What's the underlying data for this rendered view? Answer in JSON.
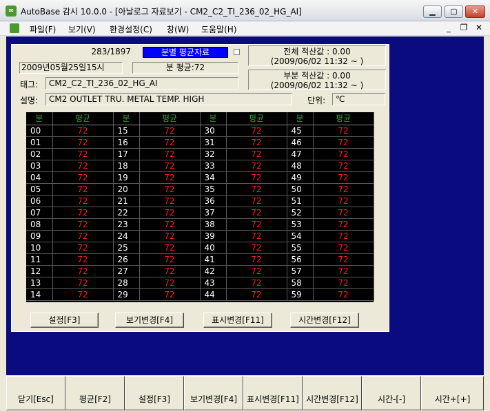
{
  "window": {
    "title": "AutoBase 감시 10.0.0 - [아날로그 자료보기 - CM2_C2_TI_236_02_HG_AI]",
    "app_icon_glyph": "∞"
  },
  "menu": {
    "items": [
      "파일(F)",
      "보기(V)",
      "환경설정(C)",
      "창(W)",
      "도움말(H)"
    ]
  },
  "info": {
    "record_count": "283/1897",
    "mode": "분별 평균자료",
    "datetime": "2009년05월25일15시",
    "minute_avg": "분 평균:72",
    "tag_label": "태그:",
    "tag_value": "CM2_C2_TI_236_02_HG_AI",
    "desc_label": "설명:",
    "desc_value": "CM2 OUTLET TRU. METAL TEMP. HIGH",
    "unit_label": "단위:",
    "unit_value": "℃",
    "total_line1": "전체 적산값 :     0.00",
    "total_line2": "(2009/06/02 11:32 ~ )",
    "partial_line1": "부분 적산값 :     0.00",
    "partial_line2": "(2009/06/02 11:32 ~ )"
  },
  "table": {
    "headers": [
      "분",
      "평균",
      "분",
      "평균",
      "분",
      "평균",
      "분",
      "평균"
    ],
    "rows": [
      [
        "00",
        "72",
        "15",
        "72",
        "30",
        "72",
        "45",
        "72"
      ],
      [
        "01",
        "72",
        "16",
        "72",
        "31",
        "72",
        "46",
        "72"
      ],
      [
        "02",
        "72",
        "17",
        "72",
        "32",
        "72",
        "47",
        "72"
      ],
      [
        "03",
        "72",
        "18",
        "72",
        "33",
        "72",
        "48",
        "72"
      ],
      [
        "04",
        "72",
        "19",
        "72",
        "34",
        "72",
        "49",
        "72"
      ],
      [
        "05",
        "72",
        "20",
        "72",
        "35",
        "72",
        "50",
        "72"
      ],
      [
        "06",
        "72",
        "21",
        "72",
        "36",
        "72",
        "51",
        "72"
      ],
      [
        "07",
        "72",
        "22",
        "72",
        "37",
        "72",
        "52",
        "72"
      ],
      [
        "08",
        "72",
        "23",
        "72",
        "38",
        "72",
        "53",
        "72"
      ],
      [
        "09",
        "72",
        "24",
        "72",
        "39",
        "72",
        "54",
        "72"
      ],
      [
        "10",
        "72",
        "25",
        "72",
        "40",
        "72",
        "55",
        "72"
      ],
      [
        "11",
        "72",
        "26",
        "72",
        "41",
        "72",
        "56",
        "72"
      ],
      [
        "12",
        "72",
        "27",
        "72",
        "42",
        "72",
        "57",
        "72"
      ],
      [
        "13",
        "72",
        "28",
        "72",
        "43",
        "72",
        "58",
        "72"
      ],
      [
        "14",
        "72",
        "29",
        "72",
        "44",
        "72",
        "59",
        "72"
      ]
    ]
  },
  "panel_buttons": [
    "설정[F3]",
    "보기변경[F4]",
    "표시변경[F11]",
    "시간변경[F12]"
  ],
  "bottom_buttons": [
    "닫기[Esc]",
    "평균[F2]",
    "설정[F3]",
    "보기변경[F4]",
    "표시변경[F11]",
    "시간변경[F12]",
    "시간-[-]",
    "시간+[+]"
  ],
  "colors": {
    "client_bg": "#0b0b80",
    "grid_bg": "#000000",
    "value_color": "#ff1a1a",
    "header_color": "#33a033",
    "mode_bg": "#0000ff"
  }
}
